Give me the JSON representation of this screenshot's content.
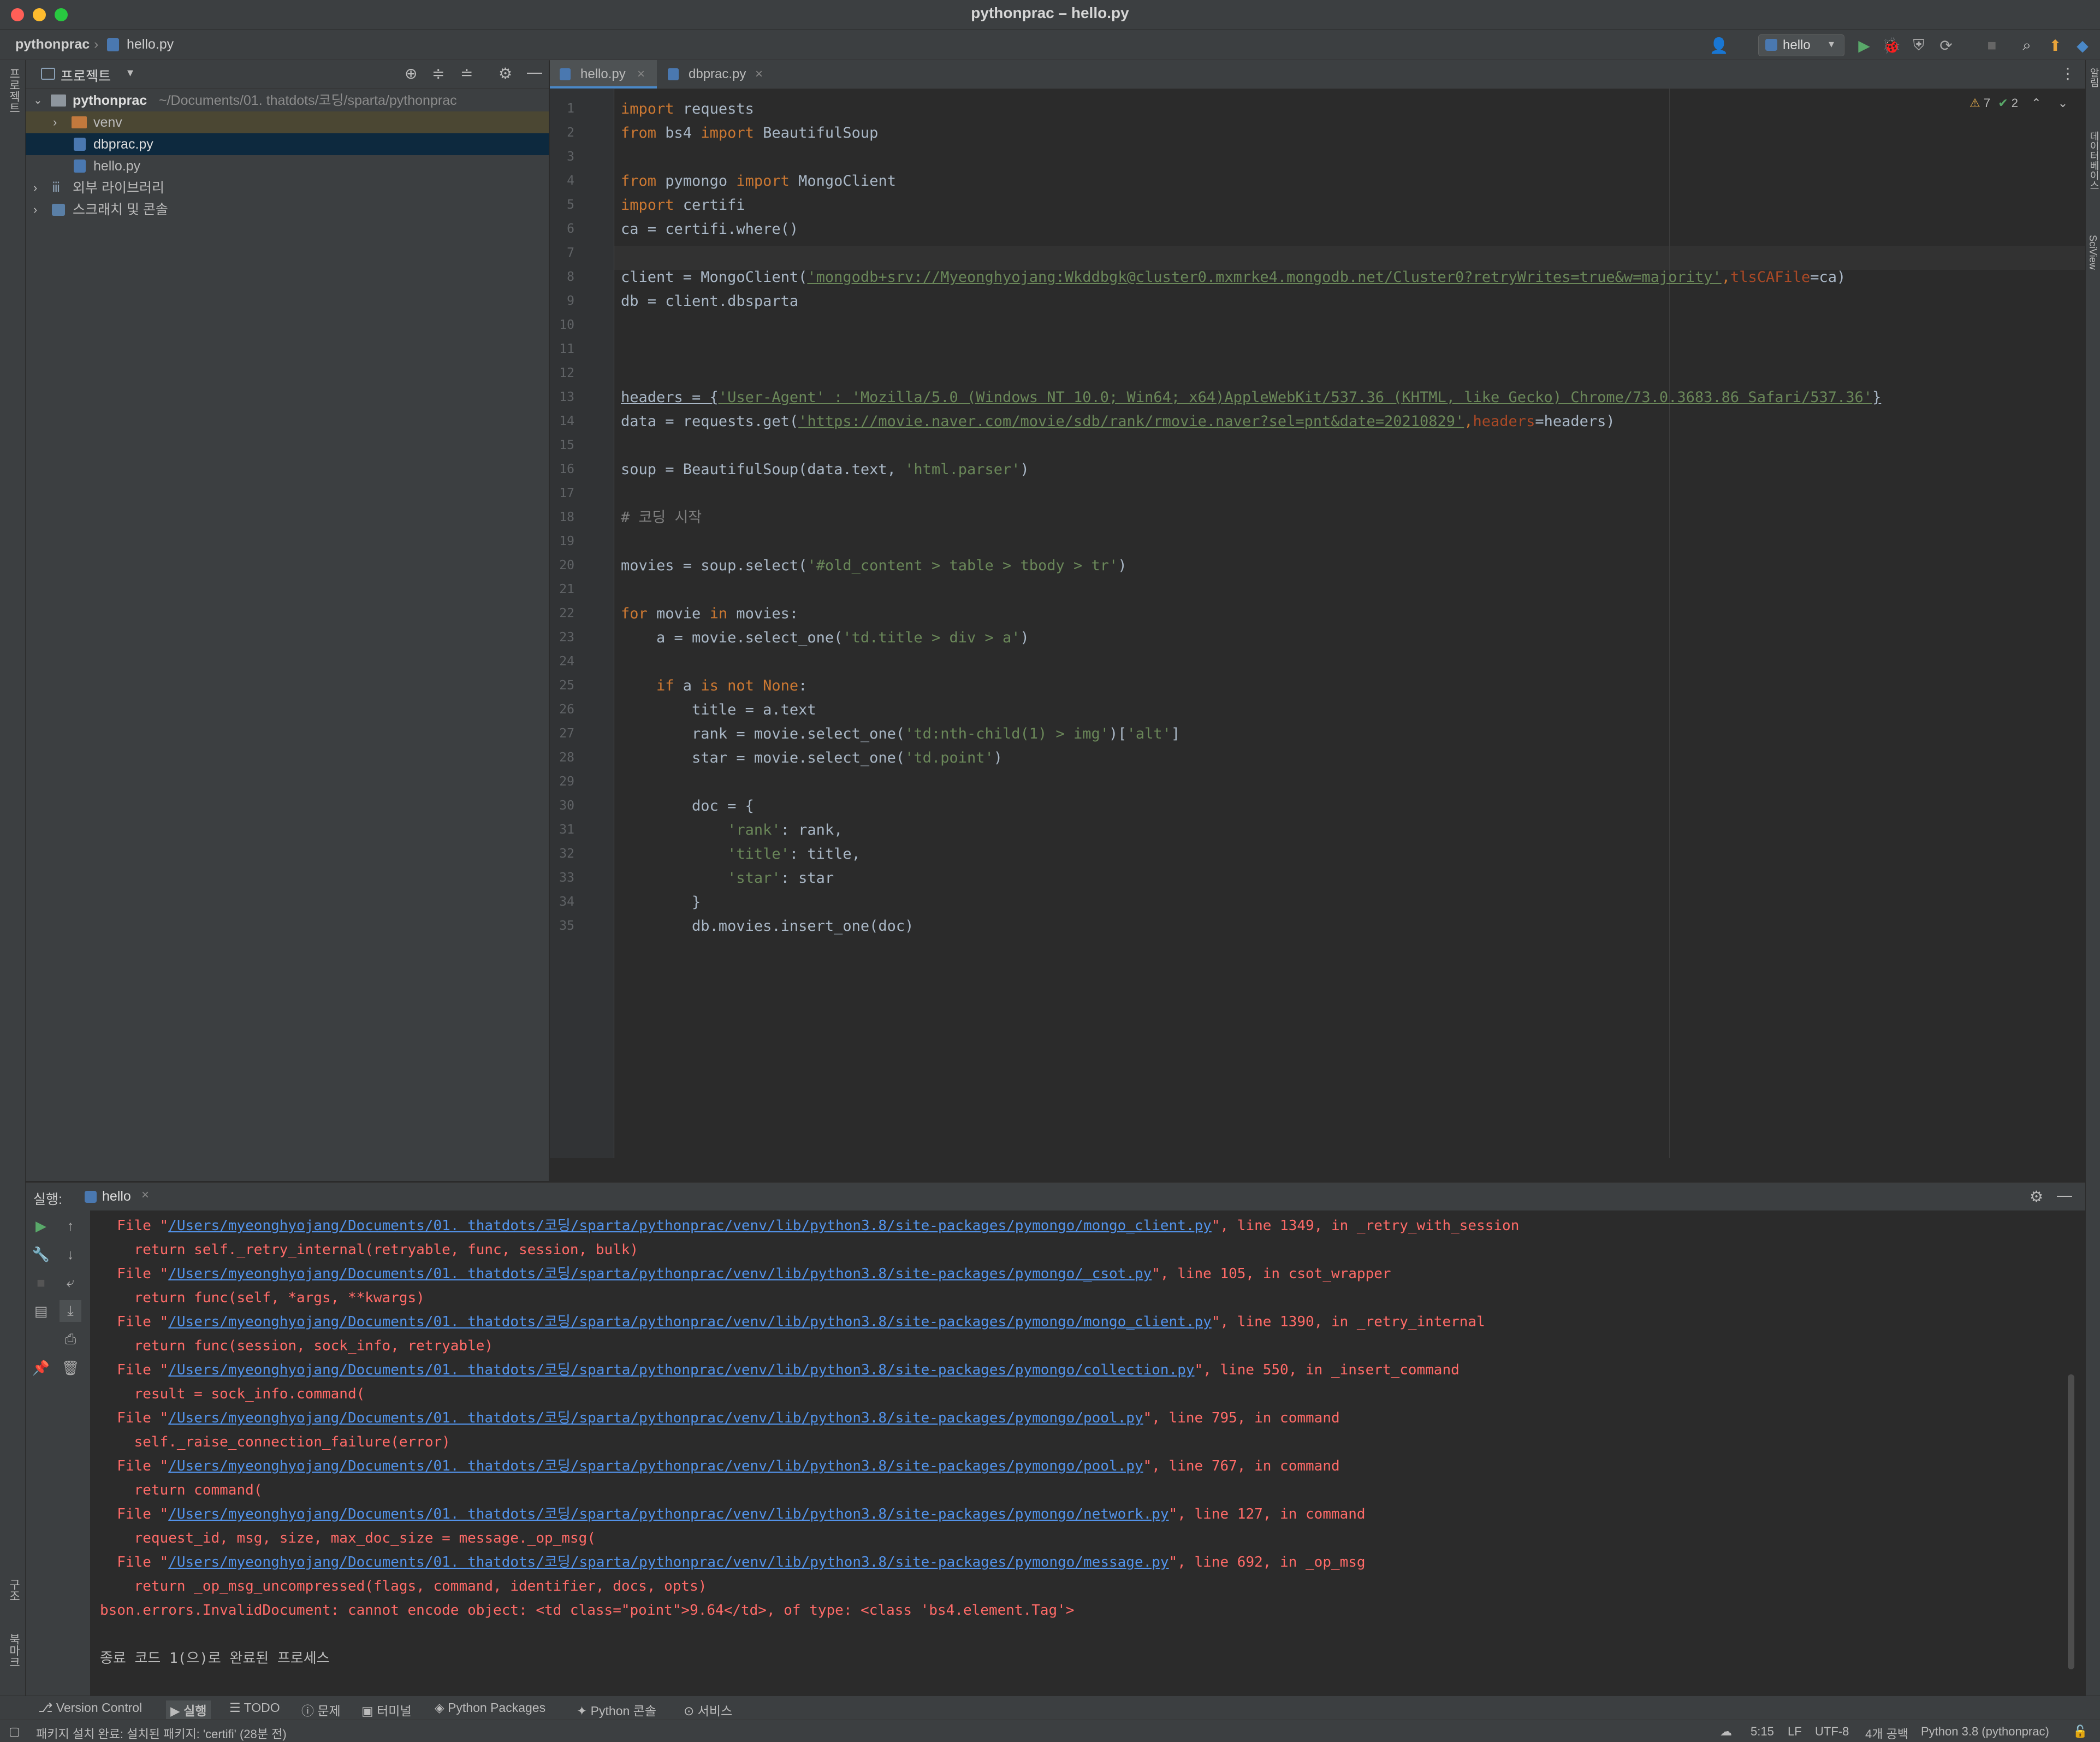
{
  "window": {
    "title": "pythonprac – hello.py"
  },
  "nav": {
    "breadcrumb_project": "pythonprac",
    "breadcrumb_file": "hello.py",
    "run_config": "hello"
  },
  "left_stripe": {
    "project_label": "프로젝트",
    "structure_label": "구조",
    "bookmarks_label": "북마크"
  },
  "right_stripe": {
    "notifications_label": "알림",
    "database_label": "데이터베이스",
    "sciview_label": "SciView"
  },
  "project": {
    "header_title": "프로젝트",
    "root_name": "pythonprac",
    "root_path": "~/Documents/01. thatdots/코딩/sparta/pythonprac",
    "items": [
      {
        "label": "venv"
      },
      {
        "label": "dbprac.py"
      },
      {
        "label": "hello.py"
      },
      {
        "label": "외부 라이브러리"
      },
      {
        "label": "스크래치 및 콘솔"
      }
    ]
  },
  "editor": {
    "tabs": [
      {
        "label": "hello.py"
      },
      {
        "label": "dbprac.py"
      }
    ],
    "inspection": {
      "warnings": "7",
      "ok": "2"
    },
    "line_numbers": [
      "1",
      "2",
      "3",
      "4",
      "5",
      "6",
      "7",
      "8",
      "9",
      "10",
      "11",
      "12",
      "13",
      "14",
      "15",
      "16",
      "17",
      "18",
      "19",
      "20",
      "21",
      "22",
      "23",
      "24",
      "25",
      "26",
      "27",
      "28",
      "29",
      "30",
      "31",
      "32",
      "33",
      "34",
      "35"
    ],
    "code": {
      "l1_kw": "import",
      "l1_rest": " requests",
      "l2_kw1": "from",
      "l2_mid": " bs4 ",
      "l2_kw2": "import",
      "l2_rest": " BeautifulSoup",
      "l4_kw1": "from",
      "l4_mid": " pymongo ",
      "l4_kw2": "import",
      "l4_rest": " MongoClient",
      "l5_kw": "import",
      "l5_rest": " certifi",
      "l6": "ca = certifi.where()",
      "l8_a": "client = MongoClient(",
      "l8_str": "'mongodb+srv://Myeonghyojang:Wkddbgk@cluster0.mxmrke4.mongodb.net/Cluster0?retryWrites=true&w=majority'",
      "l8_comma": ",",
      "l8_prm": "tlsCAFile",
      "l8_end": "=ca)",
      "l9": "db = client.dbsparta",
      "l13_a": "headers = {",
      "l13_str": "'User-Agent' : 'Mozilla/5.0 (Windows NT 10.0; Win64; x64)AppleWebKit/537.36 (KHTML, like Gecko) Chrome/73.0.3683.86 Safari/537.36'",
      "l13_end": "}",
      "l14_a": "data = requests.get(",
      "l14_str": "'https://movie.naver.com/movie/sdb/rank/rmovie.naver?sel=pnt&date=20210829'",
      "l14_comma": ",",
      "l14_prm": "headers",
      "l14_end": "=headers)",
      "l16_a": "soup = BeautifulSoup(data.text, ",
      "l16_str": "'html.parser'",
      "l16_end": ")",
      "l18": "# 코딩 시작",
      "l20_a": "movies = soup.select(",
      "l20_str": "'#old_content > table > tbody > tr'",
      "l20_end": ")",
      "l22_kw1": "for",
      "l22_mid": " movie ",
      "l22_kw2": "in",
      "l22_rest": " movies:",
      "l23_a": "    a = movie.select_one(",
      "l23_str": "'td.title > div > a'",
      "l23_end": ")",
      "l25_sp": "    ",
      "l25_kw1": "if",
      "l25_mid": " a ",
      "l25_kw2": "is not None",
      "l25_end": ":",
      "l26": "        title = a.text",
      "l27_a": "        rank = movie.select_one(",
      "l27_str1": "'td:nth-child(1) > img'",
      "l27_mid": ")[",
      "l27_str2": "'alt'",
      "l27_end": "]",
      "l28_a": "        star = movie.select_one(",
      "l28_str": "'td.point'",
      "l28_end": ")",
      "l30": "        doc = {",
      "l31_sp": "            ",
      "l31_str": "'rank'",
      "l31_end": ": rank,",
      "l32_sp": "            ",
      "l32_str": "'title'",
      "l32_end": ": title,",
      "l33_sp": "            ",
      "l33_str": "'star'",
      "l33_end": ": star",
      "l34": "        }",
      "l35": "        db.movies.insert_one(doc)"
    }
  },
  "run": {
    "label": "실행:",
    "tab": "hello",
    "output": {
      "file_prefix": "  File \"",
      "l1_path": "/Users/myeonghyojang/Documents/01. thatdots/코딩/sparta/pythonprac/venv/lib/python3.8/site-packages/pymongo/mongo_client.py",
      "l1_rest": "\", line 1349, in _retry_with_session",
      "l2": "    return self._retry_internal(retryable, func, session, bulk)",
      "l3_path": "/Users/myeonghyojang/Documents/01. thatdots/코딩/sparta/pythonprac/venv/lib/python3.8/site-packages/pymongo/_csot.py",
      "l3_rest": "\", line 105, in csot_wrapper",
      "l4": "    return func(self, *args, **kwargs)",
      "l5_path": "/Users/myeonghyojang/Documents/01. thatdots/코딩/sparta/pythonprac/venv/lib/python3.8/site-packages/pymongo/mongo_client.py",
      "l5_rest": "\", line 1390, in _retry_internal",
      "l6": "    return func(session, sock_info, retryable)",
      "l7_path": "/Users/myeonghyojang/Documents/01. thatdots/코딩/sparta/pythonprac/venv/lib/python3.8/site-packages/pymongo/collection.py",
      "l7_rest": "\", line 550, in _insert_command",
      "l8": "    result = sock_info.command(",
      "l9_path": "/Users/myeonghyojang/Documents/01. thatdots/코딩/sparta/pythonprac/venv/lib/python3.8/site-packages/pymongo/pool.py",
      "l9_rest": "\", line 795, in command",
      "l10": "    self._raise_connection_failure(error)",
      "l11_path": "/Users/myeonghyojang/Documents/01. thatdots/코딩/sparta/pythonprac/venv/lib/python3.8/site-packages/pymongo/pool.py",
      "l11_rest": "\", line 767, in command",
      "l12": "    return command(",
      "l13_path": "/Users/myeonghyojang/Documents/01. thatdots/코딩/sparta/pythonprac/venv/lib/python3.8/site-packages/pymongo/network.py",
      "l13_rest": "\", line 127, in command",
      "l14": "    request_id, msg, size, max_doc_size = message._op_msg(",
      "l15_path": "/Users/myeonghyojang/Documents/01. thatdots/코딩/sparta/pythonprac/venv/lib/python3.8/site-packages/pymongo/message.py",
      "l15_rest": "\", line 692, in _op_msg",
      "l16": "    return _op_msg_uncompressed(flags, command, identifier, docs, opts)",
      "l17": "bson.errors.InvalidDocument: cannot encode object: <td class=\"point\">9.64</td>, of type: <class 'bs4.element.Tag'>",
      "l18": "종료 코드 1(으)로 완료된 프로세스"
    }
  },
  "bottom_tools": [
    "Version Control",
    "실행",
    "TODO",
    "문제",
    "터미널",
    "Python Packages",
    "Python 콘솔",
    "서비스"
  ],
  "status": {
    "message": "패키지 설치 완료: 설치된 패키지: 'certifi' (28분 전)",
    "position": "5:15",
    "line_sep": "LF",
    "encoding": "UTF-8",
    "indent": "4개 공백",
    "interpreter": "Python 3.8 (pythonprac)"
  },
  "colors": {
    "accent": "#4a88c7",
    "keyword": "#cc7832",
    "string": "#6a8759",
    "error": "#ff6b68",
    "link": "#5394ec"
  }
}
